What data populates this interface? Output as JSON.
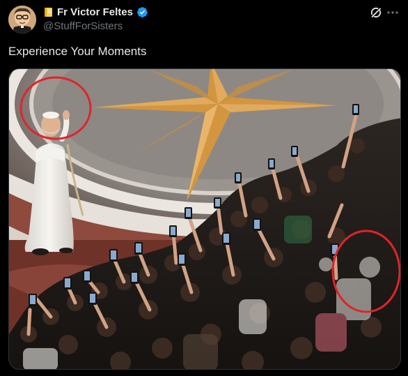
{
  "post": {
    "author_name": "Fr Victor Feltes",
    "author_handle": "@StuffForSisters",
    "text": "Experience Your Moments",
    "verified": true
  },
  "icons": {
    "avatar": "cartoon-priest-avatar",
    "badge": "notebook-emoji-icon",
    "verified": "verified-badge-icon",
    "grok": "grok-icon",
    "more": "more-options-icon"
  },
  "media": {
    "description_marks": [
      "circled-figure-left",
      "circled-figure-right"
    ]
  },
  "colors": {
    "background": "#000000",
    "text_primary": "#e7e9ea",
    "text_secondary": "#71767b",
    "verified": "#1d9bf0",
    "annotation_circle": "#e0242b"
  }
}
